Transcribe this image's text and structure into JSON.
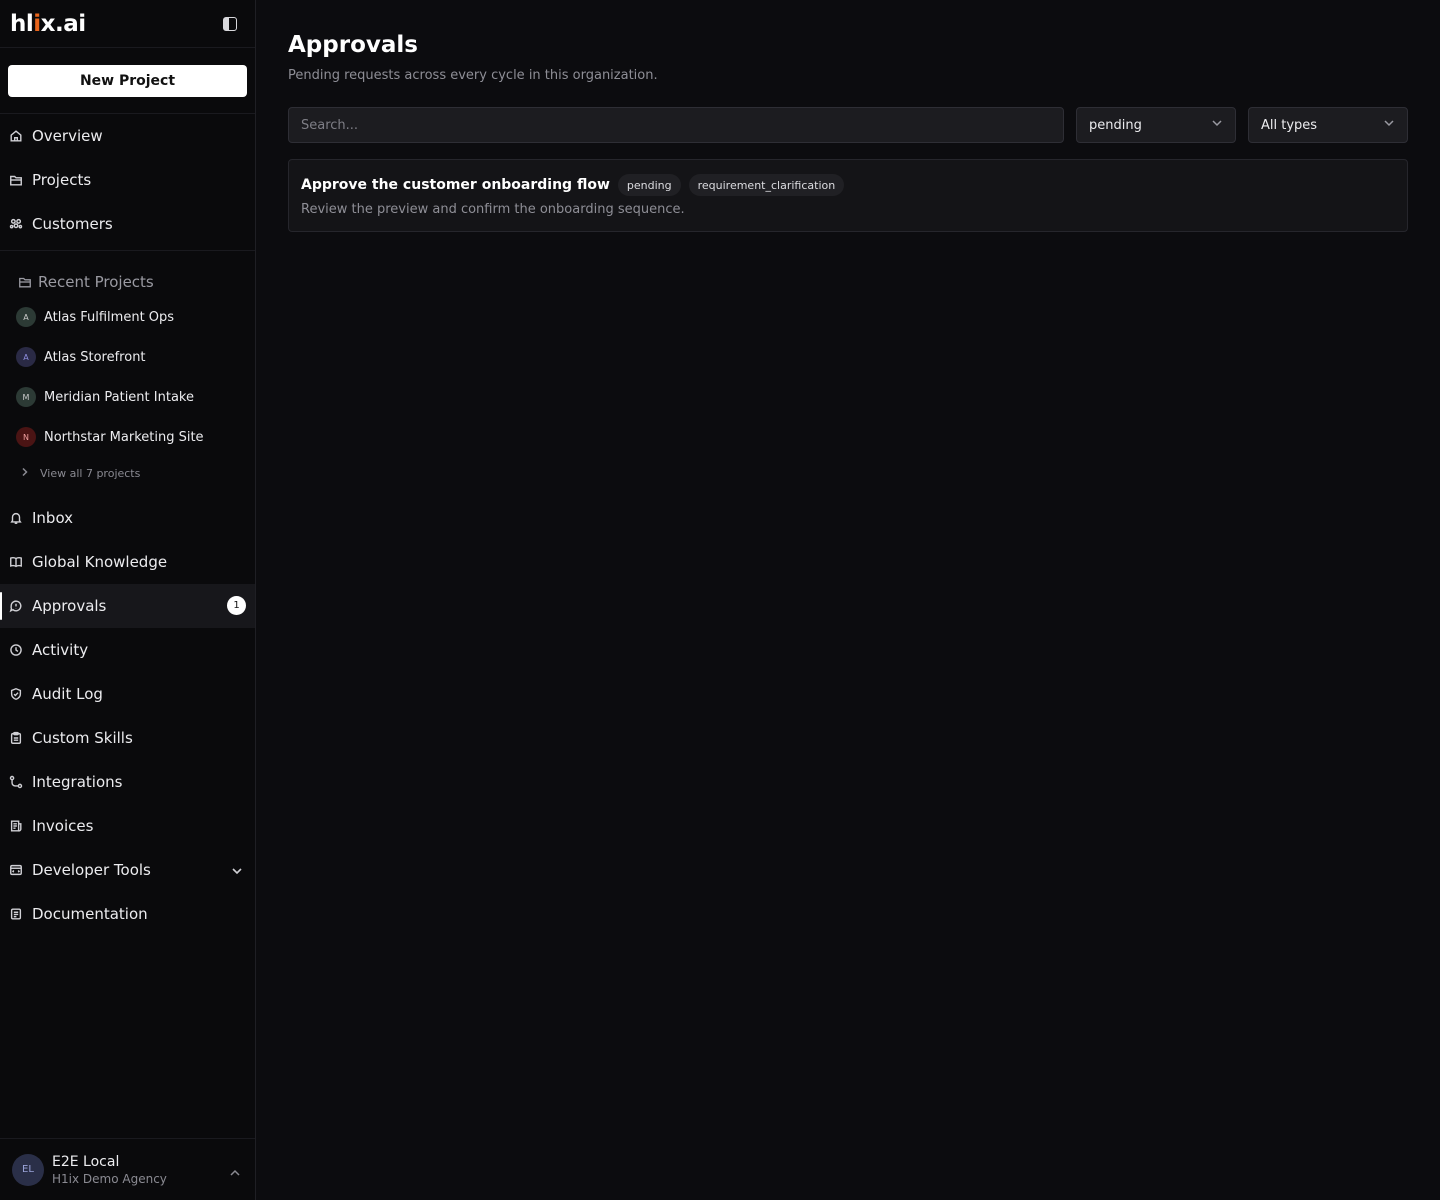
{
  "brand": {
    "logo_left": "hl",
    "logo_accent": "i",
    "logo_right": "x.ai",
    "accent_color": "#e8641b"
  },
  "sidebar": {
    "new_project_label": "New Project",
    "primary_nav": [
      {
        "label": "Overview",
        "icon": "home-icon"
      },
      {
        "label": "Projects",
        "icon": "folder-icon"
      },
      {
        "label": "Customers",
        "icon": "users-icon"
      }
    ],
    "recent_header": "Recent Projects",
    "recent_projects": [
      {
        "initial": "A",
        "label": "Atlas Fulfilment Ops",
        "color": "#2c3a35"
      },
      {
        "initial": "A",
        "label": "Atlas Storefront",
        "color": "#2a2a45"
      },
      {
        "initial": "M",
        "label": "Meridian Patient Intake",
        "color": "#2c3a35"
      },
      {
        "initial": "N",
        "label": "Northstar Marketing Site",
        "color": "#4a1414"
      }
    ],
    "view_all_label": "View all 7 projects",
    "secondary_nav": [
      {
        "label": "Inbox",
        "icon": "bell-icon"
      },
      {
        "label": "Global Knowledge",
        "icon": "book-icon"
      },
      {
        "label": "Approvals",
        "icon": "approval-icon",
        "badge": "1",
        "active": true
      },
      {
        "label": "Activity",
        "icon": "clock-icon"
      },
      {
        "label": "Audit Log",
        "icon": "shield-check-icon"
      },
      {
        "label": "Custom Skills",
        "icon": "clipboard-icon"
      },
      {
        "label": "Integrations",
        "icon": "integrations-icon"
      },
      {
        "label": "Invoices",
        "icon": "invoice-icon"
      },
      {
        "label": "Developer Tools",
        "icon": "developer-icon",
        "expandable": true
      },
      {
        "label": "Documentation",
        "icon": "document-icon"
      }
    ],
    "user": {
      "initials": "EL",
      "name": "E2E Local",
      "org": "H1ix Demo Agency"
    }
  },
  "main": {
    "title": "Approvals",
    "subtitle": "Pending requests across every cycle in this organization.",
    "search_placeholder": "Search...",
    "status_filter": "pending",
    "type_filter": "All types",
    "approvals": [
      {
        "title": "Approve the customer onboarding flow",
        "status": "pending",
        "type": "requirement_clarification",
        "description": "Review the preview and confirm the onboarding sequence."
      }
    ]
  }
}
